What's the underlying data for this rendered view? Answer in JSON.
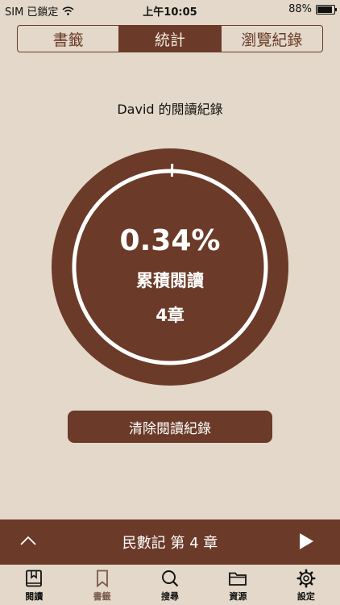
{
  "status": {
    "carrier": "SIM 已鎖定",
    "time": "上午10:05",
    "battery": "88%",
    "battery_level": 0.88
  },
  "segments": [
    {
      "label": "書籤",
      "active": false
    },
    {
      "label": "統計",
      "active": true
    },
    {
      "label": "瀏覽紀錄",
      "active": false
    }
  ],
  "record_title": "David  的閱讀紀錄",
  "progress": {
    "percent_text": "0.34%",
    "fraction": 0.0034,
    "label": "累積閱讀",
    "chapters": "4章"
  },
  "clear_button": "清除閱讀紀錄",
  "player": {
    "title": "民數記 第 4 章"
  },
  "tabs": [
    {
      "label": "閱讀",
      "icon": "book-icon",
      "active": false
    },
    {
      "label": "書籤",
      "icon": "bookmark-icon",
      "active": true
    },
    {
      "label": "搜尋",
      "icon": "search-icon",
      "active": false
    },
    {
      "label": "資源",
      "icon": "folder-icon",
      "active": false
    },
    {
      "label": "設定",
      "icon": "gear-icon",
      "active": false
    }
  ],
  "colors": {
    "accent": "#6b3a28",
    "background": "#e3d8c9",
    "active_tab": "#7a5a4a"
  }
}
